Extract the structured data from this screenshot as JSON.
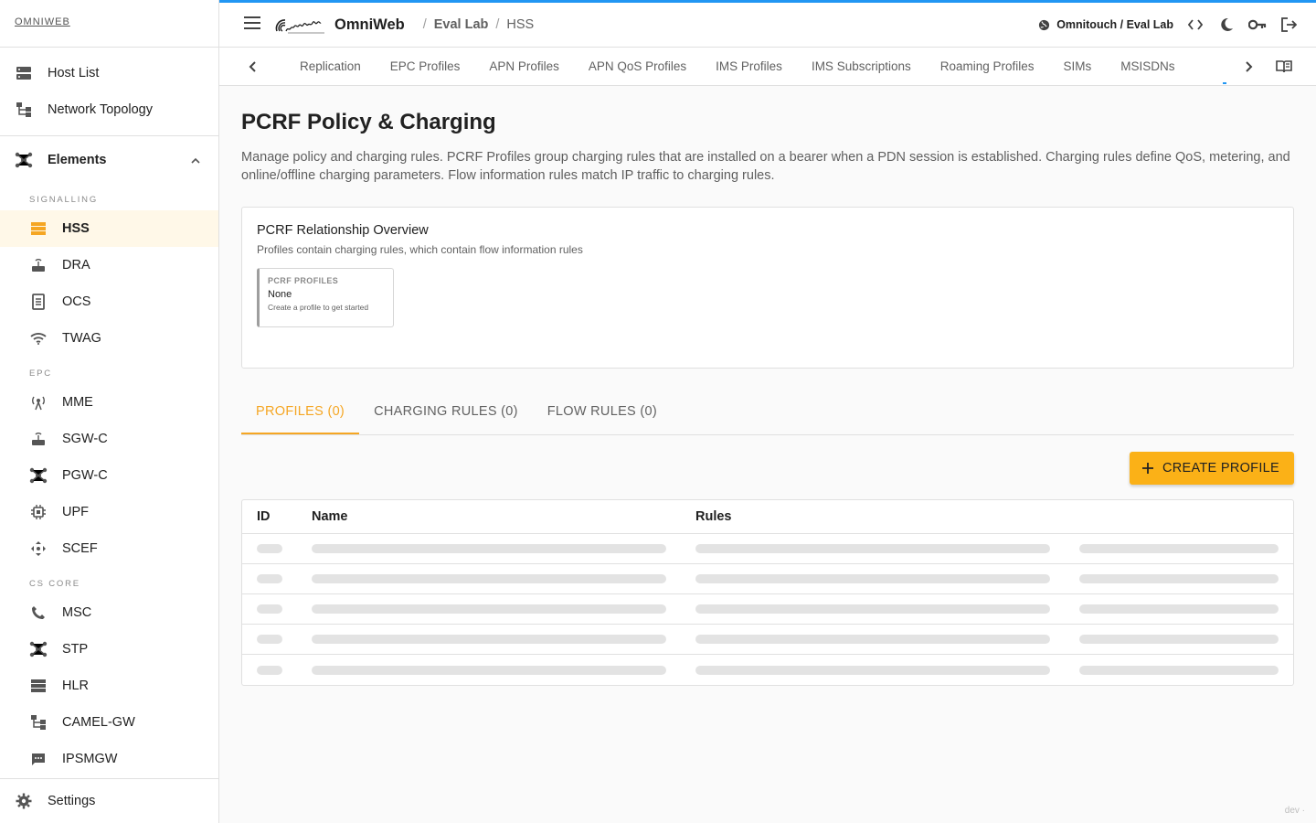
{
  "brand": "OMNIWEB",
  "sidebar": {
    "top_items": [
      {
        "label": "Host List",
        "icon": "host-list-icon"
      },
      {
        "label": "Network Topology",
        "icon": "topology-icon"
      }
    ],
    "elements_label": "Elements",
    "sections": [
      {
        "title": "SIGNALLING",
        "items": [
          "HSS",
          "DRA",
          "OCS",
          "TWAG"
        ]
      },
      {
        "title": "EPC",
        "items": [
          "MME",
          "SGW-C",
          "PGW-C",
          "UPF",
          "SCEF"
        ]
      },
      {
        "title": "CS CORE",
        "items": [
          "MSC",
          "STP",
          "HLR",
          "CAMEL-GW",
          "IPSMGW"
        ]
      }
    ],
    "active_item": "HSS",
    "settings_label": "Settings"
  },
  "header": {
    "app_name": "OmniWeb",
    "breadcrumb": [
      "Eval Lab",
      "HSS"
    ],
    "environment": "Omnitouch / Eval Lab"
  },
  "tabs": [
    "Replication",
    "EPC Profiles",
    "APN Profiles",
    "APN QoS Profiles",
    "IMS Profiles",
    "IMS Subscriptions",
    "Roaming Profiles",
    "SIMs",
    "MSISDNs"
  ],
  "page": {
    "title": "PCRF Policy & Charging",
    "description": "Manage policy and charging rules. PCRF Profiles group charging rules that are installed on a bearer when a PDN session is established. Charging rules define QoS, metering, and online/offline charging parameters. Flow information rules match IP traffic to charging rules.",
    "overview": {
      "title": "PCRF Relationship Overview",
      "subtitle": "Profiles contain charging rules, which contain flow information rules",
      "box_key": "PCRF PROFILES",
      "box_value": "None",
      "box_hint": "Create a profile to get started"
    },
    "subtabs": [
      "PROFILES (0)",
      "CHARGING RULES (0)",
      "FLOW RULES (0)"
    ],
    "active_subtab": 0,
    "create_button": "CREATE PROFILE",
    "table": {
      "columns": [
        "ID",
        "Name",
        "Rules",
        ""
      ],
      "loading_rows": 5
    }
  },
  "footer_tag": "dev ·",
  "colors": {
    "accent": "#f5a623",
    "button": "#fbb117",
    "topline": "#2196f3"
  }
}
